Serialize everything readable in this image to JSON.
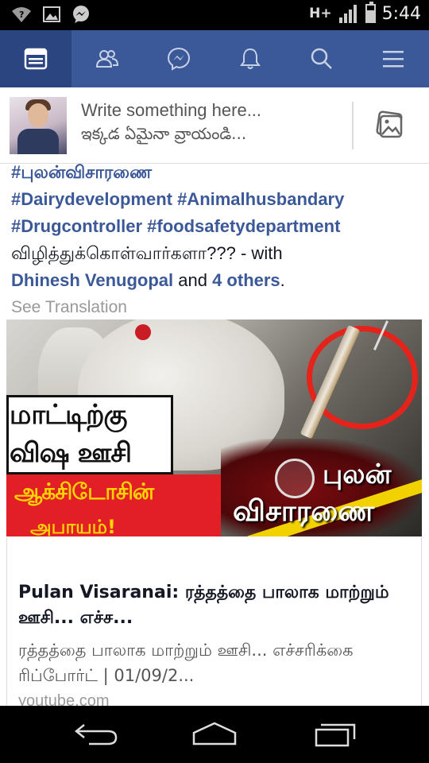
{
  "status_bar": {
    "network": "H+",
    "time": "5:44",
    "battery_level": 0.7,
    "icons": [
      "wifi-question-icon",
      "image-icon",
      "messenger-icon",
      "signal-icon",
      "battery-icon"
    ]
  },
  "fb_nav": {
    "tabs": [
      {
        "name": "news-feed",
        "icon": "news-feed-icon",
        "active": true
      },
      {
        "name": "friends",
        "icon": "friends-icon",
        "active": false
      },
      {
        "name": "messenger",
        "icon": "messenger-icon",
        "active": false
      },
      {
        "name": "notifications",
        "icon": "bell-icon",
        "active": false
      },
      {
        "name": "search",
        "icon": "search-icon",
        "active": false
      },
      {
        "name": "menu",
        "icon": "menu-icon",
        "active": false
      }
    ]
  },
  "composer": {
    "placeholder_line1": "Write something here...",
    "placeholder_line2": "ఇక్కడ ఏమైనా వ్రాయండి..."
  },
  "post": {
    "hashtag_line1": "#புலன்விசாரணை",
    "hashtag_line2": "#Dairydevelopment #Animalhusbandary",
    "hashtag_line3": "#Drugcontroller #foodsafetydepartment",
    "text_line": "விழித்துக்கொள்வார்களா??? - with",
    "tagged_user": "Dhinesh Venugopal",
    "and_text": " and ",
    "others_link": "4 others",
    "period": ".",
    "see_translation": "See Translation"
  },
  "banner": {
    "headline_line1": "மாட்டிற்கு",
    "headline_line2": "விஷ ஊசி",
    "red_text": "ஆக்சிடோசின்",
    "yellow_text": "அபாயம்!",
    "logo_line1": "புலன்",
    "logo_line2": "விசாரணை"
  },
  "link_card": {
    "title": "Pulan Visaranai: ரத்தத்தை பாலாக மாற்றும் ஊசி... எச்ச...",
    "description": "ரத்தத்தை பாலாக மாற்றும் ஊசி... எச்சரிக்கை ரிப்போர்ட் | 01/09/2...",
    "source": "youtube.com"
  },
  "android_nav": {
    "buttons": [
      "back-icon",
      "home-icon",
      "recents-icon"
    ]
  }
}
